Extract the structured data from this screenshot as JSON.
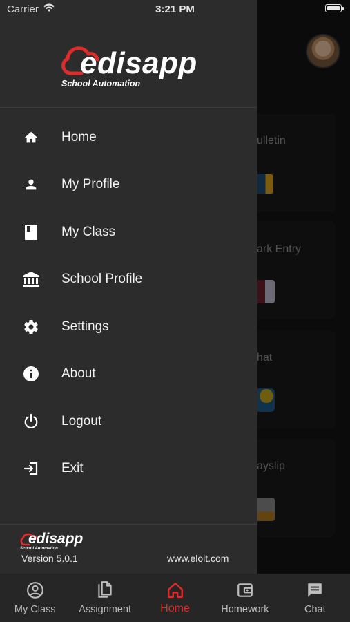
{
  "status_bar": {
    "carrier": "Carrier",
    "time": "3:21 PM"
  },
  "drawer": {
    "logo": {
      "name": "edisapp",
      "tagline": "School Automation"
    },
    "menu": [
      {
        "label": "Home",
        "icon": "home-icon"
      },
      {
        "label": "My Profile",
        "icon": "person-icon"
      },
      {
        "label": "My Class",
        "icon": "class-icon"
      },
      {
        "label": "School Profile",
        "icon": "institution-icon"
      },
      {
        "label": "Settings",
        "icon": "gear-icon"
      },
      {
        "label": "About",
        "icon": "info-icon"
      },
      {
        "label": "Logout",
        "icon": "power-icon"
      },
      {
        "label": "Exit",
        "icon": "exit-icon"
      }
    ],
    "footer": {
      "logo_name": "edisapp",
      "logo_tagline": "School Automation",
      "version": "Version 5.0.1",
      "website": "www.eloit.com"
    }
  },
  "background": {
    "cards": [
      {
        "title": "ulletin"
      },
      {
        "title": "ark Entry"
      },
      {
        "title": "hat"
      },
      {
        "title": "ayslip"
      }
    ]
  },
  "tab_bar": {
    "active": "Home",
    "accent_color": "#e12b2b",
    "tabs": [
      {
        "label": "My Class",
        "icon": "account-circle-icon"
      },
      {
        "label": "Assignment",
        "icon": "copy-icon"
      },
      {
        "label": "Home",
        "icon": "home-outline-icon"
      },
      {
        "label": "Homework",
        "icon": "wallet-icon"
      },
      {
        "label": "Chat",
        "icon": "chat-icon"
      }
    ]
  }
}
